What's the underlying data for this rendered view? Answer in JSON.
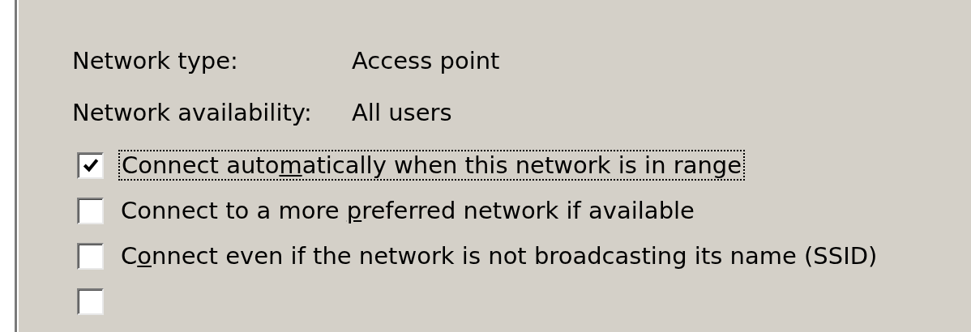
{
  "properties": [
    {
      "label": "Network type:",
      "value": "Access point"
    },
    {
      "label": "Network availability:",
      "value": "All users"
    }
  ],
  "options": [
    {
      "label": [
        "Connect auto",
        "m",
        "atically when this network is in range"
      ],
      "checked": true,
      "focused": true
    },
    {
      "label": [
        "Connect to a more ",
        "p",
        "referred network if available"
      ],
      "checked": false,
      "focused": false
    },
    {
      "label": [
        "C",
        "o",
        "nnect even if the network is not broadcasting its name (SSID)"
      ],
      "checked": false,
      "focused": false
    },
    {
      "checked": false
    }
  ]
}
